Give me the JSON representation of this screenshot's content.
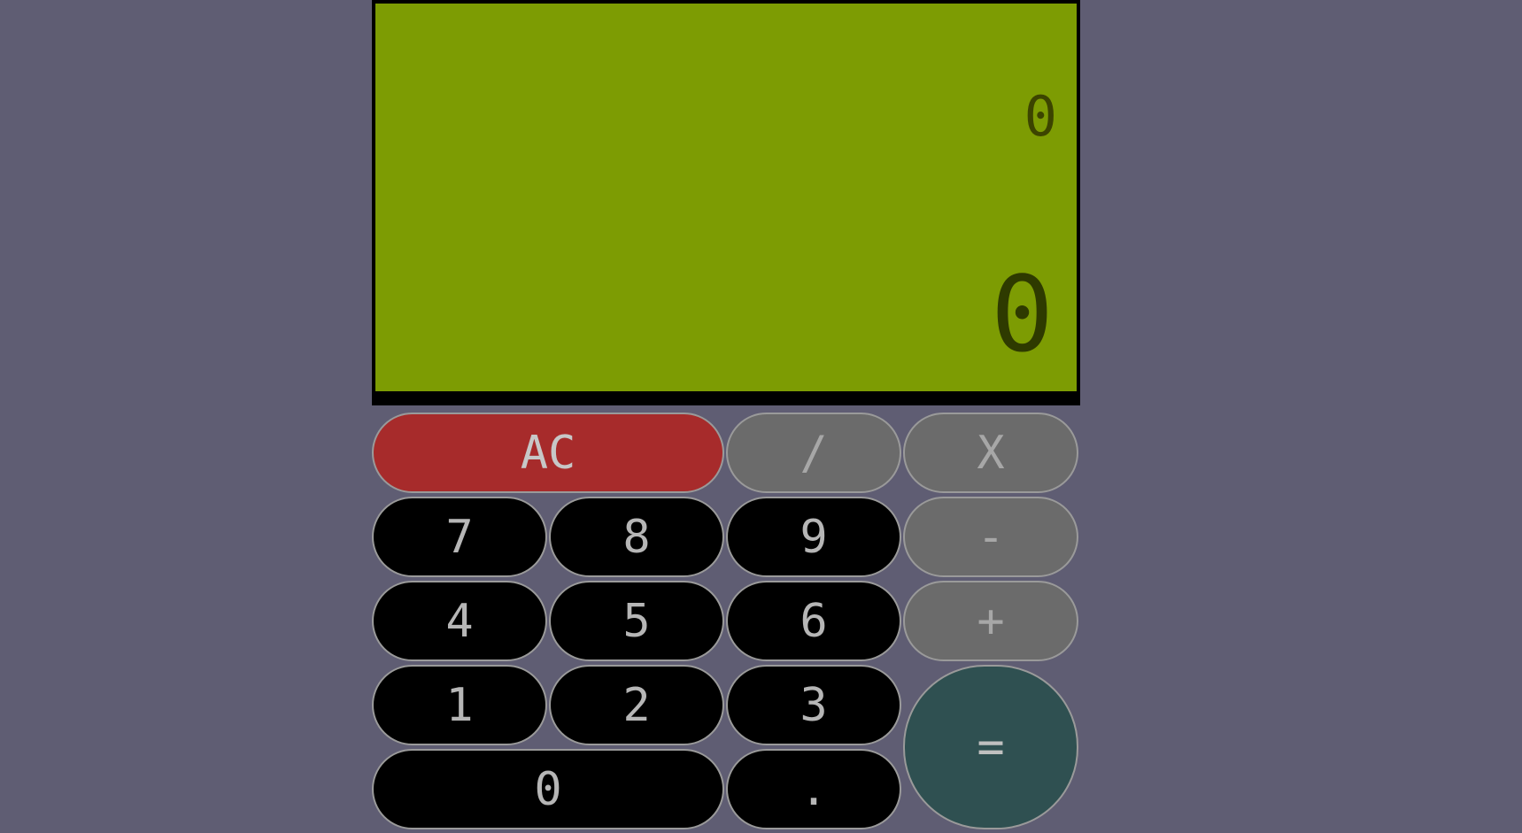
{
  "display": {
    "previous": "0",
    "current": "0"
  },
  "keys": {
    "clear": "AC",
    "divide": "/",
    "multiply": "X",
    "seven": "7",
    "eight": "8",
    "nine": "9",
    "minus": "-",
    "four": "4",
    "five": "5",
    "six": "6",
    "plus": "+",
    "one": "1",
    "two": "2",
    "three": "3",
    "equals": "=",
    "zero": "0",
    "decimal": "."
  },
  "colors": {
    "background": "#5f5d73",
    "display": "#7d9c03",
    "clear_key": "#a72b2b",
    "operator_key": "#6b6b6b",
    "digit_key": "#000000",
    "equals_key": "#2f5051"
  }
}
